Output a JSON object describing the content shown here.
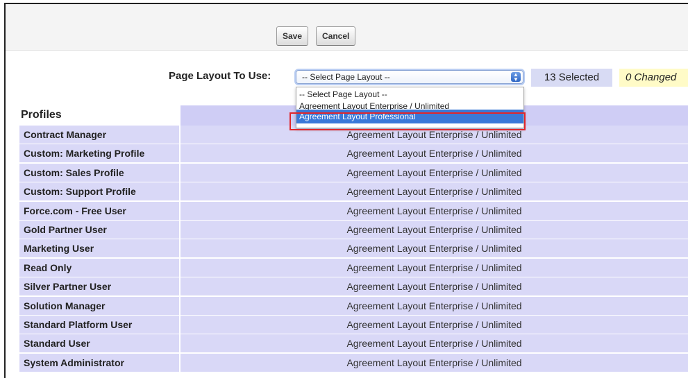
{
  "toolbar": {
    "save_label": "Save",
    "cancel_label": "Cancel"
  },
  "layout_picker": {
    "label": "Page Layout To Use:",
    "selected_value": "-- Select Page Layout --",
    "options": [
      "-- Select Page Layout --",
      "Agreement Layout Enterprise / Unlimited",
      "Agreement Layout Professional"
    ],
    "highlighted_option": "Agreement Layout Professional"
  },
  "status": {
    "selected_text": "13 Selected",
    "changed_text": "0 Changed"
  },
  "table": {
    "profiles_header": "Profiles",
    "layout_header_visible": "out",
    "rows": [
      {
        "profile": "Contract Manager",
        "layout": "Agreement Layout Enterprise / Unlimited"
      },
      {
        "profile": "Custom: Marketing Profile",
        "layout": "Agreement Layout Enterprise / Unlimited"
      },
      {
        "profile": "Custom: Sales Profile",
        "layout": "Agreement Layout Enterprise / Unlimited"
      },
      {
        "profile": "Custom: Support Profile",
        "layout": "Agreement Layout Enterprise / Unlimited"
      },
      {
        "profile": "Force.com - Free User",
        "layout": "Agreement Layout Enterprise / Unlimited"
      },
      {
        "profile": "Gold Partner User",
        "layout": "Agreement Layout Enterprise / Unlimited"
      },
      {
        "profile": "Marketing User",
        "layout": "Agreement Layout Enterprise / Unlimited"
      },
      {
        "profile": "Read Only",
        "layout": "Agreement Layout Enterprise / Unlimited"
      },
      {
        "profile": "Silver Partner User",
        "layout": "Agreement Layout Enterprise / Unlimited"
      },
      {
        "profile": "Solution Manager",
        "layout": "Agreement Layout Enterprise / Unlimited"
      },
      {
        "profile": "Standard Platform User",
        "layout": "Agreement Layout Enterprise / Unlimited"
      },
      {
        "profile": "Standard User",
        "layout": "Agreement Layout Enterprise / Unlimited"
      },
      {
        "profile": "System Administrator",
        "layout": "Agreement Layout Enterprise / Unlimited"
      }
    ]
  },
  "colors": {
    "row_bg": "#d9d8f7",
    "header_bg": "#cfcdf5",
    "selected_badge_bg": "#d8dbf4",
    "changed_badge_bg": "#fffbc7",
    "highlight_blue": "#3a78d8",
    "annotation_red": "#e0262b"
  }
}
